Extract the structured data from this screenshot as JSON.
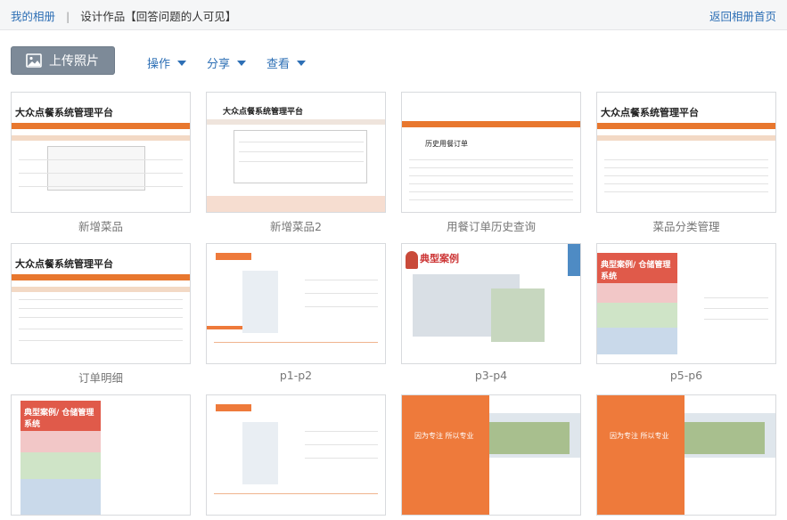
{
  "breadcrumb": {
    "home": "我的相册",
    "album": "设计作品【回答问题的人可见】"
  },
  "back_link": "返回相册首页",
  "toolbar": {
    "upload": "上传照片",
    "operate": "操作",
    "share": "分享",
    "view": "查看"
  },
  "photos": [
    {
      "caption": "新增菜品",
      "thumb_title": "大众点餐系统管理平台"
    },
    {
      "caption": "新增菜品2",
      "thumb_title": "大众点餐系统管理平台"
    },
    {
      "caption": "用餐订单历史查询",
      "thumb_title": "历史用餐订单"
    },
    {
      "caption": "菜品分类管理",
      "thumb_title": "大众点餐系统管理平台"
    },
    {
      "caption": "订单明细",
      "thumb_title": "大众点餐系统管理平台"
    },
    {
      "caption": "p1-p2",
      "thumb_title": ""
    },
    {
      "caption": "p3-p4",
      "thumb_title": "典型案例"
    },
    {
      "caption": "p5-p6",
      "thumb_title": "典型案例/ 仓储管理系统"
    },
    {
      "caption": "",
      "thumb_title": "典型案例/ 仓储管理系统"
    },
    {
      "caption": "",
      "thumb_title": ""
    },
    {
      "caption": "",
      "thumb_title": "因为专注 所以专业"
    },
    {
      "caption": "",
      "thumb_title": "因为专注 所以专业"
    }
  ],
  "colors": {
    "accent": "#2d6fb5",
    "upload_button": "#7d8a98",
    "brochure_orange": "#ee7a3b"
  }
}
